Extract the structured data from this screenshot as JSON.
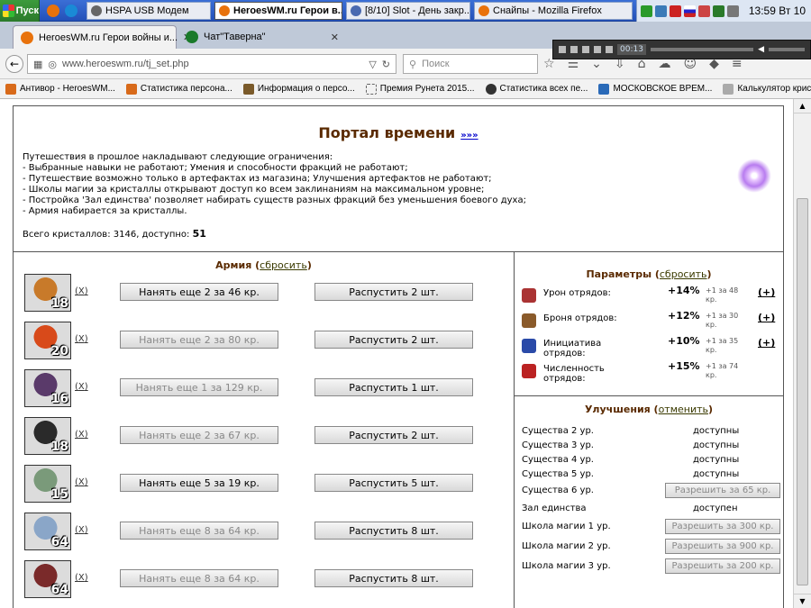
{
  "taskbar": {
    "start_label": "Пуск",
    "windows": [
      {
        "label": "HSPA USB Модем",
        "active": false
      },
      {
        "label": "HeroesWM.ru Герои в...",
        "active": true
      },
      {
        "label": "[8/10] Slot - День закр...",
        "active": false
      },
      {
        "label": "Снайпы - Mozilla Firefox",
        "active": false
      }
    ],
    "clock": "13:59 Вт 10"
  },
  "browser": {
    "tabs": [
      {
        "label": "HeroesWM.ru Герои войны и...",
        "active": true
      },
      {
        "label": "Чат\"Таверна\"",
        "active": false
      }
    ],
    "new_tab": "+",
    "url": "www.heroeswm.ru/tj_set.php",
    "search_placeholder": "Поиск",
    "media_time": "00:13",
    "bookmarks": [
      "Антивор - HeroesWM...",
      "Статистика персона...",
      "Информация о персо...",
      "Премия Рунета 2015...",
      "Статистика всех пе...",
      "МОСКОВСКОЕ ВРЕМ...",
      "Калькулятор криста..."
    ]
  },
  "portal": {
    "title": "Портал времени",
    "title_link": "»»»",
    "rules": [
      "Путешествия в прошлое накладывают следующие ограничения:",
      "- Выбранные навыки не работают; Умения и способности фракций не работают;",
      "- Путешествие возможно только в артефактах из магазина; Улучшения артефактов не работают;",
      "- Школы магии за кристаллы открывают доступ ко всем заклинаниям на максимальном уровне;",
      "- Постройка 'Зал единства' позволяет набирать существ разных фракций без уменьшения боевого духа;",
      "- Армия набирается за кристаллы."
    ],
    "crystals_label": "Всего кристаллов: 3146, доступно:",
    "crystals_available": "51"
  },
  "army": {
    "title": "Армия",
    "reset_label": "сбросить",
    "x_label": "X",
    "units": [
      {
        "count": "18",
        "hire": "Нанять еще 2 за 46 кр.",
        "hire_enabled": true,
        "dismiss": "Распустить 2 шт.",
        "color": "#c87a2a"
      },
      {
        "count": "20",
        "hire": "Нанять еще 2 за 80 кр.",
        "hire_enabled": false,
        "dismiss": "Распустить 2 шт.",
        "color": "#d84a1a"
      },
      {
        "count": "16",
        "hire": "Нанять еще 1 за 129 кр.",
        "hire_enabled": false,
        "dismiss": "Распустить 1 шт.",
        "color": "#5a3a6a"
      },
      {
        "count": "18",
        "hire": "Нанять еще 2 за 67 кр.",
        "hire_enabled": false,
        "dismiss": "Распустить 2 шт.",
        "color": "#2a2a2a"
      },
      {
        "count": "15",
        "hire": "Нанять еще 5 за 19 кр.",
        "hire_enabled": true,
        "dismiss": "Распустить 5 шт.",
        "color": "#7a9a7a"
      },
      {
        "count": "64",
        "hire": "Нанять еще 8 за 64 кр.",
        "hire_enabled": false,
        "dismiss": "Распустить 8 шт.",
        "color": "#8aa6c8"
      },
      {
        "count": "64",
        "hire": "Нанять еще 8 за 64 кр.",
        "hire_enabled": false,
        "dismiss": "Распустить 8 шт.",
        "color": "#7a2a2a"
      }
    ]
  },
  "params": {
    "title": "Параметры",
    "reset_label": "сбросить",
    "items": [
      {
        "label": "Урон отрядов:",
        "value": "+14%",
        "bonus": "+1 за 48 кр.",
        "plus": "(+)"
      },
      {
        "label": "Броня отрядов:",
        "value": "+12%",
        "bonus": "+1 за 30 кр.",
        "plus": "(+)"
      },
      {
        "label": "Инициатива отрядов:",
        "value": "+10%",
        "bonus": "+1 за 35 кр.",
        "plus": "(+)"
      },
      {
        "label": "Численность отрядов:",
        "value": "+15%",
        "bonus": "+1 за 74 кр.",
        "plus": ""
      }
    ]
  },
  "upgrades": {
    "title": "Улучшения",
    "cancel_label": "отменить",
    "items": [
      {
        "name": "Существа 2 ур.",
        "status": "доступны",
        "button": ""
      },
      {
        "name": "Существа 3 ур.",
        "status": "доступны",
        "button": ""
      },
      {
        "name": "Существа 4 ур.",
        "status": "доступны",
        "button": ""
      },
      {
        "name": "Существа 5 ур.",
        "status": "доступны",
        "button": ""
      },
      {
        "name": "Существа 6 ур.",
        "status": "",
        "button": "Разрешить за 65 кр."
      },
      {
        "name": "Зал единства",
        "status": "доступен",
        "button": ""
      },
      {
        "name": "Школа магии 1 ур.",
        "status": "",
        "button": "Разрешить за 300 кр."
      },
      {
        "name": "Школа магии 2 ур.",
        "status": "",
        "button": "Разрешить за 900 кр."
      },
      {
        "name": "Школа магии 3 ур.",
        "status": "",
        "button": "Разрешить за 200 кр."
      }
    ]
  }
}
